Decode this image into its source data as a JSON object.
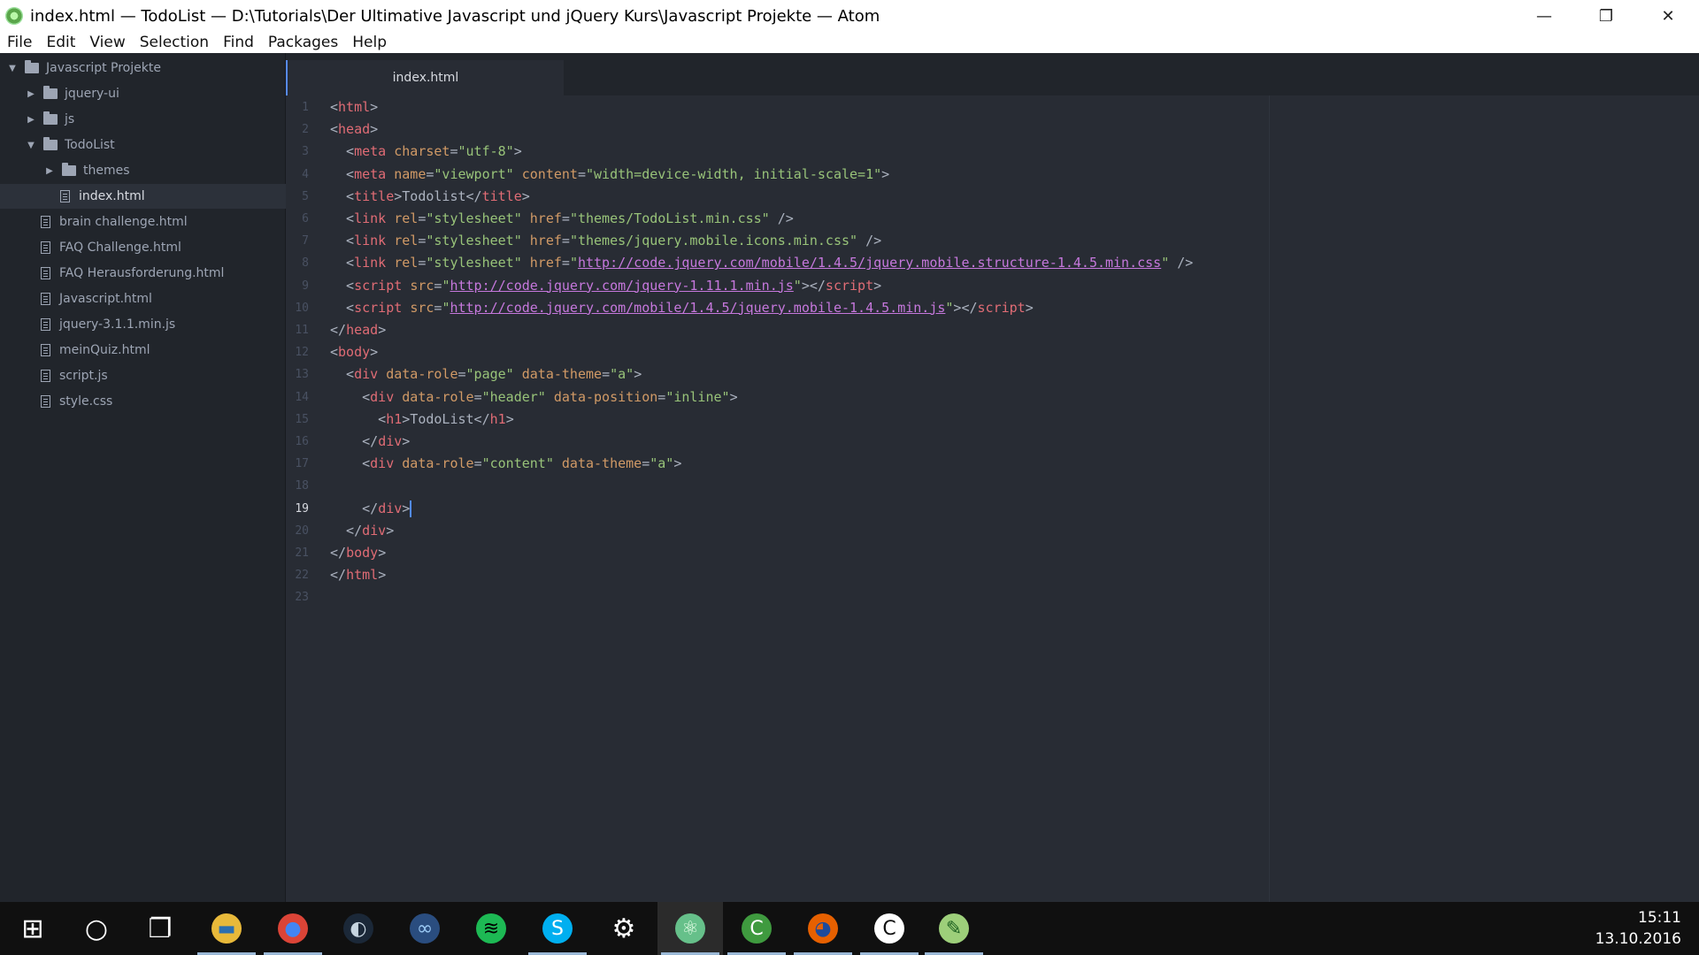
{
  "window": {
    "title": "index.html — TodoList — D:\\Tutorials\\Der Ultimative Javascript und jQuery Kurs\\Javascript Projekte — Atom",
    "controls": {
      "minimize": "—",
      "restore": "❐",
      "close": "✕"
    }
  },
  "menu": [
    "File",
    "Edit",
    "View",
    "Selection",
    "Find",
    "Packages",
    "Help"
  ],
  "tree": {
    "root": "Javascript Projekte",
    "items": [
      {
        "label": "jquery-ui",
        "kind": "folder",
        "expanded": false,
        "depth": 1
      },
      {
        "label": "js",
        "kind": "folder",
        "expanded": false,
        "depth": 1
      },
      {
        "label": "TodoList",
        "kind": "folder",
        "expanded": true,
        "depth": 1
      },
      {
        "label": "themes",
        "kind": "folder",
        "expanded": false,
        "depth": 2
      },
      {
        "label": "index.html",
        "kind": "file",
        "selected": true,
        "depth": 3
      },
      {
        "label": "brain challenge.html",
        "kind": "file",
        "depth": 1
      },
      {
        "label": "FAQ Challenge.html",
        "kind": "file",
        "depth": 1
      },
      {
        "label": "FAQ Herausforderung.html",
        "kind": "file",
        "depth": 1
      },
      {
        "label": "Javascript.html",
        "kind": "file",
        "depth": 1
      },
      {
        "label": "jquery-3.1.1.min.js",
        "kind": "file",
        "depth": 1
      },
      {
        "label": "meinQuiz.html",
        "kind": "file",
        "depth": 1
      },
      {
        "label": "script.js",
        "kind": "file",
        "depth": 1
      },
      {
        "label": "style.css",
        "kind": "file",
        "depth": 1
      }
    ]
  },
  "tab": {
    "label": "index.html"
  },
  "editor": {
    "active_line": 19,
    "lines": [
      [
        [
          "p",
          "<"
        ],
        [
          "t",
          "html"
        ],
        [
          "p",
          ">"
        ]
      ],
      [
        [
          "p",
          "<"
        ],
        [
          "t",
          "head"
        ],
        [
          "p",
          ">"
        ]
      ],
      [
        [
          "p",
          "  <"
        ],
        [
          "t",
          "meta"
        ],
        [
          "p",
          " "
        ],
        [
          "a",
          "charset"
        ],
        [
          "p",
          "="
        ],
        [
          "s",
          "\"utf-8\""
        ],
        [
          "p",
          ">"
        ]
      ],
      [
        [
          "p",
          "  <"
        ],
        [
          "t",
          "meta"
        ],
        [
          "p",
          " "
        ],
        [
          "a",
          "name"
        ],
        [
          "p",
          "="
        ],
        [
          "s",
          "\"viewport\""
        ],
        [
          "p",
          " "
        ],
        [
          "a",
          "content"
        ],
        [
          "p",
          "="
        ],
        [
          "s",
          "\"width=device-width, initial-scale=1\""
        ],
        [
          "p",
          ">"
        ]
      ],
      [
        [
          "p",
          "  <"
        ],
        [
          "t",
          "title"
        ],
        [
          "p",
          ">Todolist</"
        ],
        [
          "t",
          "title"
        ],
        [
          "p",
          ">"
        ]
      ],
      [
        [
          "p",
          "  <"
        ],
        [
          "t",
          "link"
        ],
        [
          "p",
          " "
        ],
        [
          "a",
          "rel"
        ],
        [
          "p",
          "="
        ],
        [
          "s",
          "\"stylesheet\""
        ],
        [
          "p",
          " "
        ],
        [
          "a",
          "href"
        ],
        [
          "p",
          "="
        ],
        [
          "s",
          "\"themes/TodoList.min.css\""
        ],
        [
          "p",
          " />"
        ]
      ],
      [
        [
          "p",
          "  <"
        ],
        [
          "t",
          "link"
        ],
        [
          "p",
          " "
        ],
        [
          "a",
          "rel"
        ],
        [
          "p",
          "="
        ],
        [
          "s",
          "\"stylesheet\""
        ],
        [
          "p",
          " "
        ],
        [
          "a",
          "href"
        ],
        [
          "p",
          "="
        ],
        [
          "s",
          "\"themes/jquery.mobile.icons.min.css\""
        ],
        [
          "p",
          " />"
        ]
      ],
      [
        [
          "p",
          "  <"
        ],
        [
          "t",
          "link"
        ],
        [
          "p",
          " "
        ],
        [
          "a",
          "rel"
        ],
        [
          "p",
          "="
        ],
        [
          "s",
          "\"stylesheet\""
        ],
        [
          "p",
          " "
        ],
        [
          "a",
          "href"
        ],
        [
          "p",
          "="
        ],
        [
          "s",
          "\""
        ],
        [
          "u",
          "http://code.jquery.com/mobile/1.4.5/jquery.mobile.structure-1.4.5.min.css"
        ],
        [
          "s",
          "\""
        ],
        [
          "p",
          " />"
        ]
      ],
      [
        [
          "p",
          "  <"
        ],
        [
          "t",
          "script"
        ],
        [
          "p",
          " "
        ],
        [
          "a",
          "src"
        ],
        [
          "p",
          "="
        ],
        [
          "s",
          "\""
        ],
        [
          "u",
          "http://code.jquery.com/jquery-1.11.1.min.js"
        ],
        [
          "s",
          "\""
        ],
        [
          "p",
          "></"
        ],
        [
          "t",
          "script"
        ],
        [
          "p",
          ">"
        ]
      ],
      [
        [
          "p",
          "  <"
        ],
        [
          "t",
          "script"
        ],
        [
          "p",
          " "
        ],
        [
          "a",
          "src"
        ],
        [
          "p",
          "="
        ],
        [
          "s",
          "\""
        ],
        [
          "u",
          "http://code.jquery.com/mobile/1.4.5/jquery.mobile-1.4.5.min.js"
        ],
        [
          "s",
          "\""
        ],
        [
          "p",
          "></"
        ],
        [
          "t",
          "script"
        ],
        [
          "p",
          ">"
        ]
      ],
      [
        [
          "p",
          "</"
        ],
        [
          "t",
          "head"
        ],
        [
          "p",
          ">"
        ]
      ],
      [
        [
          "p",
          "<"
        ],
        [
          "t",
          "body"
        ],
        [
          "p",
          ">"
        ]
      ],
      [
        [
          "p",
          "  <"
        ],
        [
          "t",
          "div"
        ],
        [
          "p",
          " "
        ],
        [
          "a",
          "data-role"
        ],
        [
          "p",
          "="
        ],
        [
          "s",
          "\"page\""
        ],
        [
          "p",
          " "
        ],
        [
          "a",
          "data-theme"
        ],
        [
          "p",
          "="
        ],
        [
          "s",
          "\"a\""
        ],
        [
          "p",
          ">"
        ]
      ],
      [
        [
          "p",
          "    <"
        ],
        [
          "t",
          "div"
        ],
        [
          "p",
          " "
        ],
        [
          "a",
          "data-role"
        ],
        [
          "p",
          "="
        ],
        [
          "s",
          "\"header\""
        ],
        [
          "p",
          " "
        ],
        [
          "a",
          "data-position"
        ],
        [
          "p",
          "="
        ],
        [
          "s",
          "\"inline\""
        ],
        [
          "p",
          ">"
        ]
      ],
      [
        [
          "p",
          "      <"
        ],
        [
          "t",
          "h1"
        ],
        [
          "p",
          ">TodoList</"
        ],
        [
          "t",
          "h1"
        ],
        [
          "p",
          ">"
        ]
      ],
      [
        [
          "p",
          "    </"
        ],
        [
          "t",
          "div"
        ],
        [
          "p",
          ">"
        ]
      ],
      [
        [
          "p",
          "    <"
        ],
        [
          "t",
          "div"
        ],
        [
          "p",
          " "
        ],
        [
          "a",
          "data-role"
        ],
        [
          "p",
          "="
        ],
        [
          "s",
          "\"content\""
        ],
        [
          "p",
          " "
        ],
        [
          "a",
          "data-theme"
        ],
        [
          "p",
          "="
        ],
        [
          "s",
          "\"a\""
        ],
        [
          "p",
          ">"
        ]
      ],
      [],
      [
        [
          "p",
          "    </"
        ],
        [
          "t",
          "div"
        ],
        [
          "p",
          ">"
        ]
      ],
      [
        [
          "p",
          "  </"
        ],
        [
          "t",
          "div"
        ],
        [
          "p",
          ">"
        ]
      ],
      [
        [
          "p",
          "</"
        ],
        [
          "t",
          "body"
        ],
        [
          "p",
          ">"
        ]
      ],
      [
        [
          "p",
          "</"
        ],
        [
          "t",
          "html"
        ],
        [
          "p",
          ">"
        ]
      ],
      []
    ]
  },
  "taskbar": {
    "items": [
      {
        "name": "start-button",
        "glyph": "⊞",
        "bg": "transparent",
        "color": "#ffffff",
        "running": false
      },
      {
        "name": "cortana-button",
        "glyph": "○",
        "bg": "transparent",
        "color": "#ffffff",
        "running": false
      },
      {
        "name": "task-view-button",
        "glyph": "❐",
        "bg": "transparent",
        "color": "#ffffff",
        "running": false
      },
      {
        "name": "file-explorer-icon",
        "glyph": "▬",
        "bg": "#e8b93a",
        "color": "#2b6fb0",
        "running": true
      },
      {
        "name": "chrome-icon",
        "glyph": "●",
        "bg": "#db4437",
        "color": "#4285f4",
        "running": true
      },
      {
        "name": "steam-icon",
        "glyph": "◐",
        "bg": "#1b2838",
        "color": "#c7d5e0",
        "running": false
      },
      {
        "name": "visual-studio-icon",
        "glyph": "∞",
        "bg": "#2a4d7f",
        "color": "#9ccaf5",
        "running": false
      },
      {
        "name": "spotify-icon",
        "glyph": "≋",
        "bg": "#1db954",
        "color": "#000000",
        "running": false
      },
      {
        "name": "skype-icon",
        "glyph": "S",
        "bg": "#00aff0",
        "color": "#ffffff",
        "running": true
      },
      {
        "name": "settings-icon",
        "glyph": "⚙",
        "bg": "transparent",
        "color": "#ffffff",
        "running": false
      },
      {
        "name": "atom-icon",
        "glyph": "⚛",
        "bg": "#66c08a",
        "color": "#e9ffe9",
        "running": true,
        "active": true
      },
      {
        "name": "camtasia-green-icon",
        "glyph": "C",
        "bg": "#3f9a3f",
        "color": "#ffffff",
        "running": true
      },
      {
        "name": "firefox-icon",
        "glyph": "◕",
        "bg": "#e66000",
        "color": "#1c4a9c",
        "running": true
      },
      {
        "name": "camtasia-white-icon",
        "glyph": "C",
        "bg": "#ffffff",
        "color": "#111111",
        "running": true
      },
      {
        "name": "notepad-icon",
        "glyph": "✎",
        "bg": "#9dcf7a",
        "color": "#1b5e20",
        "running": true
      }
    ],
    "clock_time": "15:11",
    "clock_date": "13.10.2016"
  }
}
